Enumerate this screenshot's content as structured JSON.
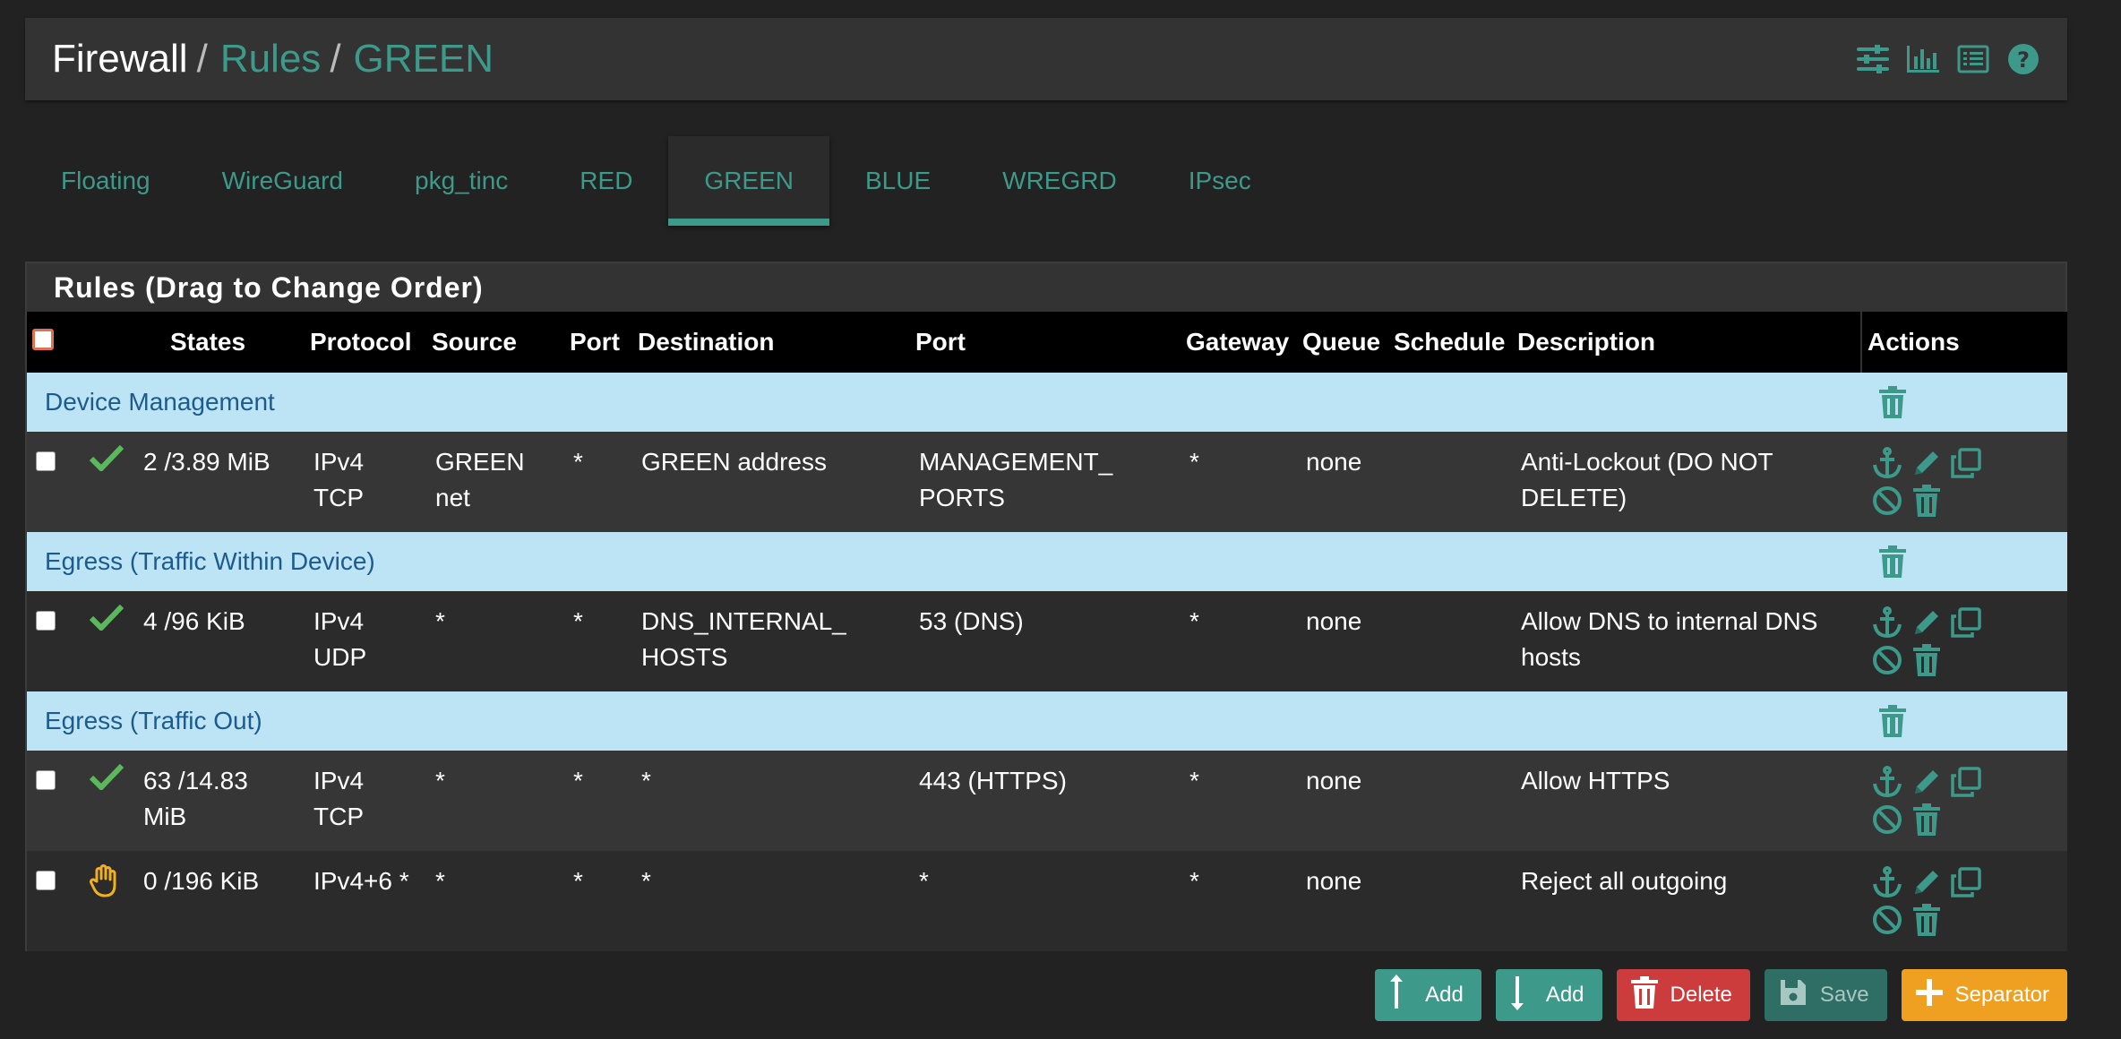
{
  "breadcrumb": {
    "root": "Firewall",
    "separator": "/",
    "section": "Rules",
    "current": "GREEN"
  },
  "header_icons": [
    "sliders-icon",
    "bar-chart-icon",
    "list-icon",
    "help-icon"
  ],
  "tabs": [
    {
      "label": "Floating",
      "active": false
    },
    {
      "label": "WireGuard",
      "active": false
    },
    {
      "label": "pkg_tinc",
      "active": false
    },
    {
      "label": "RED",
      "active": false
    },
    {
      "label": "GREEN",
      "active": true
    },
    {
      "label": "BLUE",
      "active": false
    },
    {
      "label": "WREGRD",
      "active": false
    },
    {
      "label": "IPsec",
      "active": false
    }
  ],
  "panel": {
    "title": "Rules (Drag to Change Order)",
    "columns": {
      "states": "States",
      "protocol": "Protocol",
      "source": "Source",
      "source_port": "Port",
      "destination": "Destination",
      "dest_port": "Port",
      "gateway": "Gateway",
      "queue": "Queue",
      "schedule": "Schedule",
      "description": "Description",
      "actions": "Actions"
    },
    "separators": [
      "Device Management",
      "Egress (Traffic Within Device)",
      "Egress (Traffic Out)"
    ],
    "rules": [
      {
        "status": "check",
        "states": "2 /3.89 MiB",
        "protocol_1": "IPv4",
        "protocol_2": "TCP",
        "source_1": "GREEN",
        "source_2": "net",
        "source_port": "*",
        "destination_1": "GREEN address",
        "destination_2": "",
        "dest_port_1": "MANAGEMENT_",
        "dest_port_2": "PORTS",
        "gateway": "*",
        "queue": "none",
        "schedule": "",
        "description_1": "Anti-Lockout (DO NOT",
        "description_2": "DELETE)"
      },
      {
        "status": "check",
        "states": "4 /96 KiB",
        "protocol_1": "IPv4",
        "protocol_2": "UDP",
        "source_1": "*",
        "source_2": "",
        "source_port": "*",
        "destination_1": "DNS_INTERNAL_",
        "destination_2": "HOSTS",
        "dest_port_1": "53 (DNS)",
        "dest_port_2": "",
        "gateway": "*",
        "queue": "none",
        "schedule": "",
        "description_1": "Allow DNS to internal DNS",
        "description_2": "hosts"
      },
      {
        "status": "check",
        "states_1": "63 /14.83",
        "states_2": "MiB",
        "protocol_1": "IPv4",
        "protocol_2": "TCP",
        "source_1": "*",
        "source_2": "",
        "source_port": "*",
        "destination_1": "*",
        "destination_2": "",
        "dest_port_1": "443 (HTTPS)",
        "dest_port_2": "",
        "gateway": "*",
        "queue": "none",
        "schedule": "",
        "description_1": "Allow HTTPS",
        "description_2": ""
      },
      {
        "status": "hand",
        "states": "0 /196 KiB",
        "protocol_1": "IPv4+6 *",
        "protocol_2": "",
        "source_1": "*",
        "source_2": "",
        "source_port": "*",
        "destination_1": "*",
        "destination_2": "",
        "dest_port_1": "*",
        "dest_port_2": "",
        "gateway": "*",
        "queue": "none",
        "schedule": "",
        "description_1": "Reject all outgoing",
        "description_2": ""
      }
    ]
  },
  "buttons": {
    "add_top": "Add",
    "add_bottom": "Add",
    "delete": "Delete",
    "save": "Save",
    "separator": "Separator"
  },
  "colors": {
    "accent": "#3d9a8a",
    "separator_bg": "#bce4f4",
    "separator_text": "#1d5b8e",
    "pass_check": "#5cb85c",
    "reject_hand": "#f0b020",
    "delete": "#cc3c3c",
    "separator_button": "#f0a020"
  }
}
